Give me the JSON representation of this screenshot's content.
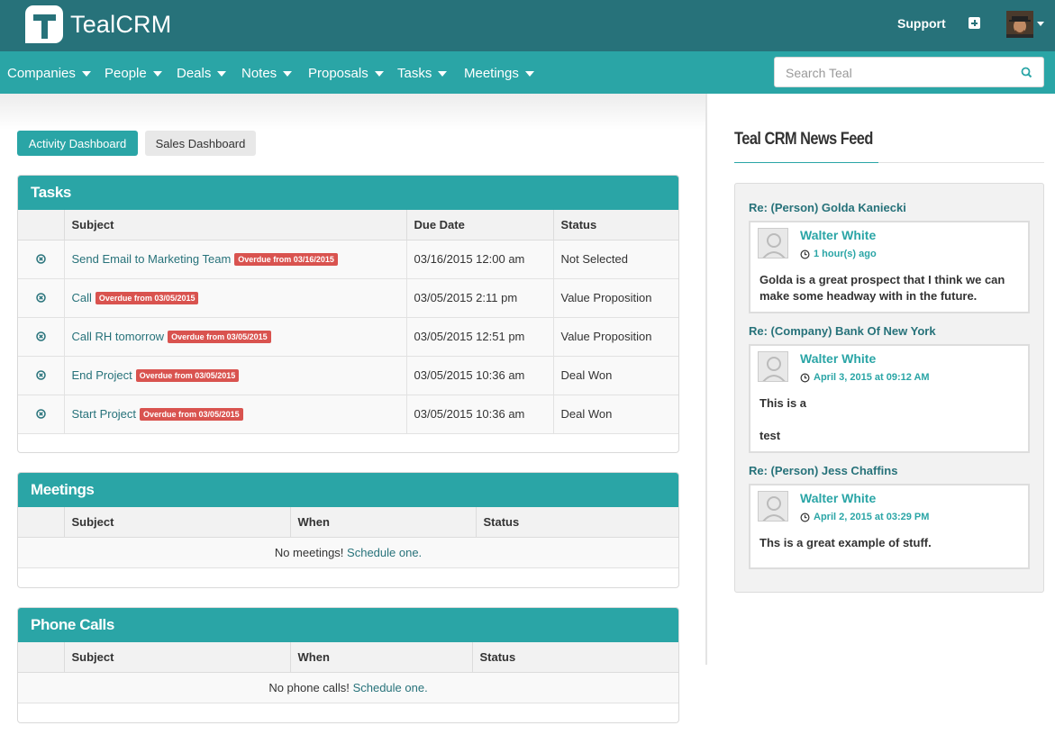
{
  "app": {
    "name": "TealCRM"
  },
  "topbar": {
    "support_label": "Support"
  },
  "nav": {
    "items": [
      "Companies",
      "People",
      "Deals",
      "Notes",
      "Proposals",
      "Tasks",
      "Meetings"
    ],
    "search_placeholder": "Search Teal"
  },
  "dashboard_tabs": {
    "active": "Activity Dashboard",
    "inactive": "Sales Dashboard"
  },
  "tasks": {
    "title": "Tasks",
    "columns": [
      "Subject",
      "Due Date",
      "Status"
    ],
    "rows": [
      {
        "subject": "Send Email to Marketing Team",
        "badge": "Overdue from 03/16/2015",
        "due": "03/16/2015 12:00 am",
        "status": "Not Selected"
      },
      {
        "subject": "Call",
        "badge": "Overdue from 03/05/2015",
        "due": "03/05/2015 2:11 pm",
        "status": "Value Proposition"
      },
      {
        "subject": "Call RH tomorrow",
        "badge": "Overdue from 03/05/2015",
        "due": "03/05/2015 12:51 pm",
        "status": "Value Proposition"
      },
      {
        "subject": "End Project",
        "badge": "Overdue from 03/05/2015",
        "due": "03/05/2015 10:36 am",
        "status": "Deal Won"
      },
      {
        "subject": "Start Project",
        "badge": "Overdue from 03/05/2015",
        "due": "03/05/2015 10:36 am",
        "status": "Deal Won"
      }
    ]
  },
  "meetings": {
    "title": "Meetings",
    "columns": [
      "Subject",
      "When",
      "Status"
    ],
    "empty_text": "No meetings!",
    "empty_link": "Schedule one."
  },
  "phone_calls": {
    "title": "Phone Calls",
    "columns": [
      "Subject",
      "When",
      "Status"
    ],
    "empty_text": "No phone calls!",
    "empty_link": "Schedule one."
  },
  "news_feed": {
    "title": "Teal CRM News Feed",
    "items": [
      {
        "re": "Re: (Person) Golda Kaniecki",
        "author": "Walter White",
        "time": "1 hour(s) ago",
        "body": [
          "Golda is a great prospect that I think we can make some headway with in the future."
        ]
      },
      {
        "re": "Re: (Company) Bank Of New York",
        "author": "Walter White",
        "time": "April 3, 2015 at 09:12 AM",
        "body": [
          "This is a",
          "test"
        ]
      },
      {
        "re": "Re: (Person) Jess Chaffins",
        "author": "Walter White",
        "time": "April 2, 2015 at 03:29 PM",
        "body": [
          "Ths is a great example of stuff."
        ]
      }
    ]
  },
  "colors": {
    "topbar": "#27727a",
    "navbar": "#2aa5a6",
    "accent": "#2aa5a6",
    "link": "#27727a",
    "danger": "#d9534f"
  },
  "icons": [
    "teal-logo-icon",
    "plus-icon",
    "user-avatar-icon",
    "search-icon",
    "remove-task-icon",
    "clock-icon",
    "default-avatar-icon"
  ]
}
